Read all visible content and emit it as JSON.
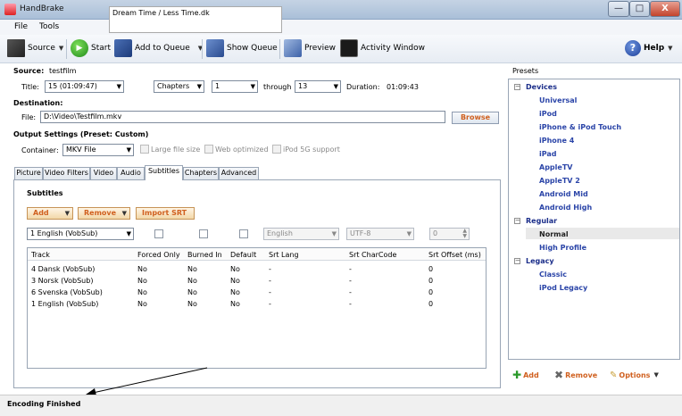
{
  "window": {
    "title": "HandBrake",
    "overlay_tab_text": "Dream Time / Less Time.dk",
    "controls": {
      "minimize": "—",
      "maximize": "□",
      "close": "X"
    }
  },
  "menu": [
    "File",
    "Tools"
  ],
  "toolbar": {
    "source": "Source",
    "start": "Start",
    "add_to_queue": "Add to Queue",
    "show_queue": "Show Queue",
    "preview": "Preview",
    "activity_window": "Activity Window",
    "help": "Help"
  },
  "source": {
    "label": "Source:",
    "name": "testfilm",
    "title_label": "Title:",
    "title_value": "15 (01:09:47)",
    "mode_value": "Chapters",
    "from_value": "1",
    "through_label": "through",
    "to_value": "13",
    "duration_label": "Duration:",
    "duration_value": "01:09:43"
  },
  "destination": {
    "label": "Destination:",
    "file_label": "File:",
    "file_value": "D:\\Video\\Testfilm.mkv",
    "browse": "Browse"
  },
  "output": {
    "label": "Output Settings (Preset: Custom)",
    "container_label": "Container:",
    "container_value": "MKV File",
    "large_file": "Large file size",
    "web_optimized": "Web optimized",
    "ipod_5g": "iPod 5G support"
  },
  "tabs": [
    "Picture",
    "Video Filters",
    "Video",
    "Audio",
    "Subtitles",
    "Chapters",
    "Advanced"
  ],
  "active_tab": "Subtitles",
  "subtitles": {
    "heading": "Subtitles",
    "add": "Add",
    "remove": "Remove",
    "import_srt": "Import SRT",
    "track_value": "1 English (VobSub)",
    "srt_lang_value": "English",
    "srt_charcode_value": "UTF-8",
    "srt_offset_value": "0",
    "columns": [
      "Track",
      "Forced Only",
      "Burned In",
      "Default",
      "Srt Lang",
      "Srt CharCode",
      "Srt Offset (ms)"
    ],
    "rows": [
      [
        "4 Dansk (VobSub)",
        "No",
        "No",
        "No",
        "-",
        "-",
        "0"
      ],
      [
        "3 Norsk (VobSub)",
        "No",
        "No",
        "No",
        "-",
        "-",
        "0"
      ],
      [
        "6 Svenska (VobSub)",
        "No",
        "No",
        "No",
        "-",
        "-",
        "0"
      ],
      [
        "1 English (VobSub)",
        "No",
        "No",
        "No",
        "-",
        "-",
        "0"
      ]
    ]
  },
  "status": "Encoding Finished",
  "presets": {
    "title": "Presets",
    "groups": [
      {
        "name": "Devices",
        "items": [
          "Universal",
          "iPod",
          "iPhone & iPod Touch",
          "iPhone 4",
          "iPad",
          "AppleTV",
          "AppleTV 2",
          "Android Mid",
          "Android High"
        ]
      },
      {
        "name": "Regular",
        "items": [
          "Normal",
          "High Profile"
        ]
      },
      {
        "name": "Legacy",
        "items": [
          "Classic",
          "iPod Legacy"
        ]
      }
    ],
    "selected": "Normal",
    "add": "Add",
    "remove": "Remove",
    "options": "Options"
  },
  "colors": {
    "accent_orange": "#d0601f",
    "preset_blue": "#2b45a8",
    "titlebar": "#b7c9de"
  }
}
